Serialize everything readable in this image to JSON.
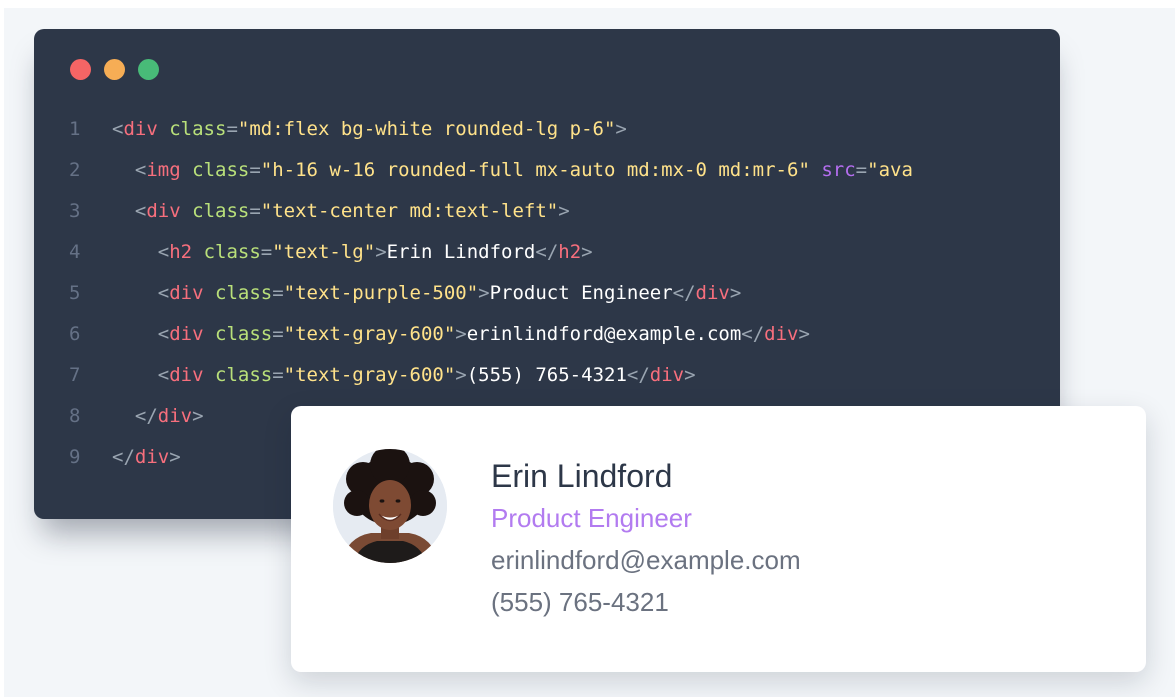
{
  "window": {
    "controls": [
      {
        "name": "close",
        "color": "#f56565"
      },
      {
        "name": "minimize",
        "color": "#f6ad55"
      },
      {
        "name": "maximize",
        "color": "#48bb78"
      }
    ]
  },
  "code": {
    "line_numbers": [
      "1",
      "2",
      "3",
      "4",
      "5",
      "6",
      "7",
      "8",
      "9"
    ],
    "tokens": {
      "lt": "<",
      "gt": ">",
      "close_lt": "</",
      "eq": "=",
      "q": "\"",
      "div": "div",
      "img": "img",
      "h2": "h2",
      "class": "class",
      "src": "src"
    },
    "line1": {
      "class_value": "md:flex bg-white rounded-lg p-6"
    },
    "line2": {
      "class_value": "h-16 w-16 rounded-full mx-auto md:mx-0 md:mr-6",
      "src_value_partial": "ava"
    },
    "line3": {
      "class_value": "text-center md:text-left"
    },
    "line4": {
      "class_value": "text-lg",
      "content": "Erin Lindford"
    },
    "line5": {
      "class_value": "text-purple-500",
      "content": "Product Engineer"
    },
    "line6": {
      "class_value": "text-gray-600",
      "content": "erinlindford@example.com"
    },
    "line7": {
      "class_value": "text-gray-600",
      "content": "(555) 765-4321"
    }
  },
  "card": {
    "avatar_icon": "avatar-portrait",
    "name": "Erin Lindford",
    "role": "Product Engineer",
    "email": "erinlindford@example.com",
    "phone": "(555) 765-4321"
  },
  "colors": {
    "editor_bg": "#2d3748",
    "tag": "#f76f7d",
    "attribute": "#b9e07a",
    "string": "#ffe28a",
    "role_text": "#b27bf0",
    "muted_text": "#6b7280"
  }
}
